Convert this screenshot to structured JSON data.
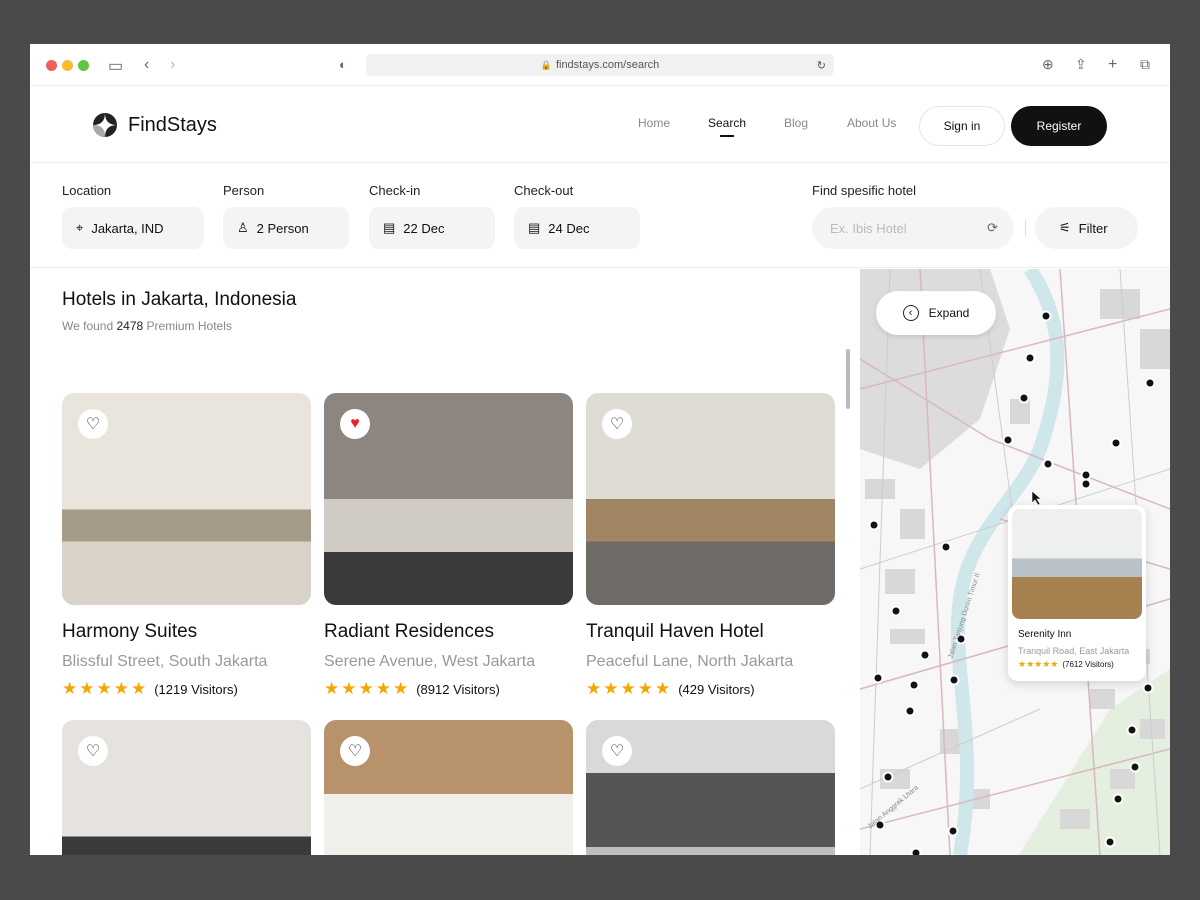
{
  "browser": {
    "url": "findstays.com/search"
  },
  "nav": {
    "brand": "FindStays",
    "items": [
      "Home",
      "Search",
      "Blog",
      "About Us"
    ],
    "active": "Search",
    "sign_in": "Sign in",
    "register": "Register"
  },
  "search": {
    "location": {
      "label": "Location",
      "value": "Jakarta, IND"
    },
    "person": {
      "label": "Person",
      "value": "2 Person"
    },
    "checkin": {
      "label": "Check-in",
      "value": "22 Dec"
    },
    "checkout": {
      "label": "Check-out",
      "value": "24 Dec"
    },
    "hotel": {
      "label": "Find spesific hotel",
      "placeholder": "Ex. Ibis Hotel"
    },
    "filter": "Filter"
  },
  "results": {
    "title_prefix": "Hotels in ",
    "title_place": "Jakarta, Indonesia",
    "found_prefix": "We found ",
    "count": "2478",
    "found_suffix": " Premium Hotels"
  },
  "hotels": [
    {
      "name": "Harmony Suites",
      "address": "Blissful Street, South Jakarta",
      "rating": 5,
      "visitors": "(1219 Visitors)",
      "favorite": false
    },
    {
      "name": "Radiant Residences",
      "address": "Serene Avenue, West Jakarta",
      "rating": 5,
      "visitors": "(8912 Visitors)",
      "favorite": true
    },
    {
      "name": "Tranquil Haven Hotel",
      "address": "Peaceful Lane, North Jakarta",
      "rating": 5,
      "visitors": "(429 Visitors)",
      "favorite": false
    },
    {
      "favorite": false
    },
    {
      "favorite": false
    },
    {
      "favorite": false
    }
  ],
  "map": {
    "expand": "Expand",
    "popup": {
      "name": "Serenity Inn",
      "address": "Tranquil Road, East Jakarta",
      "rating": 5,
      "visitors": "(7612 Visitors)"
    },
    "street_labels": [
      "Jalan Tanjung Duren Timur II",
      "Jalan Anggrek Utara"
    ]
  },
  "colors": {
    "accent": "#111111",
    "star": "#f5a700",
    "favorite": "#e8212b",
    "river": "#cfe6ea"
  }
}
